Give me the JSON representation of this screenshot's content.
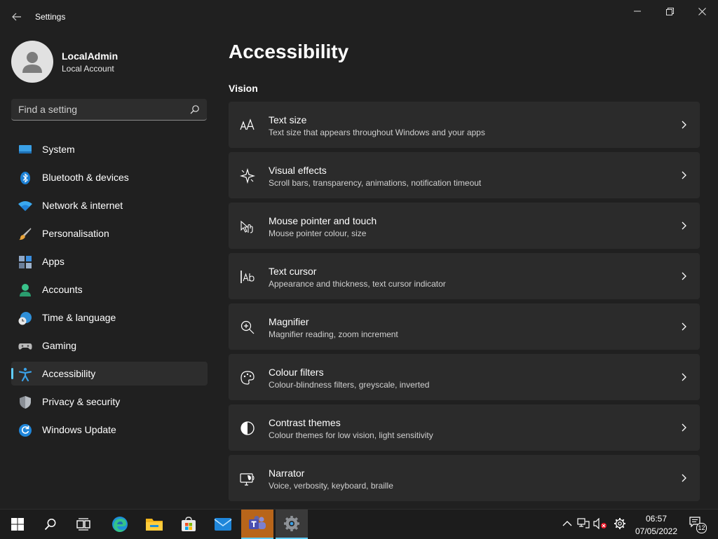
{
  "window": {
    "title": "Settings",
    "icons": {
      "back": "back-arrow-icon",
      "minimize": "minimize-icon",
      "maximize": "restore-icon",
      "close": "close-icon"
    }
  },
  "user": {
    "name": "LocalAdmin",
    "account_type": "Local Account"
  },
  "search": {
    "placeholder": "Find a setting",
    "value": ""
  },
  "sidebar": {
    "selected": "Accessibility",
    "accent": "#60cdff",
    "items": [
      {
        "label": "System",
        "icon": "system-icon"
      },
      {
        "label": "Bluetooth & devices",
        "icon": "bluetooth-icon"
      },
      {
        "label": "Network & internet",
        "icon": "wifi-icon"
      },
      {
        "label": "Personalisation",
        "icon": "brush-icon"
      },
      {
        "label": "Apps",
        "icon": "apps-icon"
      },
      {
        "label": "Accounts",
        "icon": "accounts-icon"
      },
      {
        "label": "Time & language",
        "icon": "time-language-icon"
      },
      {
        "label": "Gaming",
        "icon": "gamepad-icon"
      },
      {
        "label": "Accessibility",
        "icon": "accessibility-icon"
      },
      {
        "label": "Privacy & security",
        "icon": "shield-icon"
      },
      {
        "label": "Windows Update",
        "icon": "update-icon"
      }
    ]
  },
  "main": {
    "title": "Accessibility",
    "section": "Vision",
    "cards": [
      {
        "title": "Text size",
        "description": "Text size that appears throughout Windows and your apps",
        "icon": "text-size-icon"
      },
      {
        "title": "Visual effects",
        "description": "Scroll bars, transparency, animations, notification timeout",
        "icon": "sparkle-icon"
      },
      {
        "title": "Mouse pointer and touch",
        "description": "Mouse pointer colour, size",
        "icon": "pointer-touch-icon"
      },
      {
        "title": "Text cursor",
        "description": "Appearance and thickness, text cursor indicator",
        "icon": "text-cursor-icon"
      },
      {
        "title": "Magnifier",
        "description": "Magnifier reading, zoom increment",
        "icon": "magnifier-icon"
      },
      {
        "title": "Colour filters",
        "description": "Colour-blindness filters, greyscale, inverted",
        "icon": "palette-icon"
      },
      {
        "title": "Contrast themes",
        "description": "Colour themes for low vision, light sensitivity",
        "icon": "contrast-icon"
      },
      {
        "title": "Narrator",
        "description": "Voice, verbosity, keyboard, braille",
        "icon": "narrator-icon"
      }
    ]
  },
  "taskbar": {
    "apps": [
      "start-icon",
      "search-icon",
      "task-view-icon",
      "edge-icon",
      "file-explorer-icon",
      "store-icon",
      "mail-icon",
      "teams-icon",
      "settings-icon"
    ],
    "tray": [
      "chevron-up-icon",
      "network-icon",
      "volume-muted-icon",
      "gear-icon"
    ],
    "time": "06:57",
    "date": "07/05/2022",
    "notification_count": "12"
  }
}
